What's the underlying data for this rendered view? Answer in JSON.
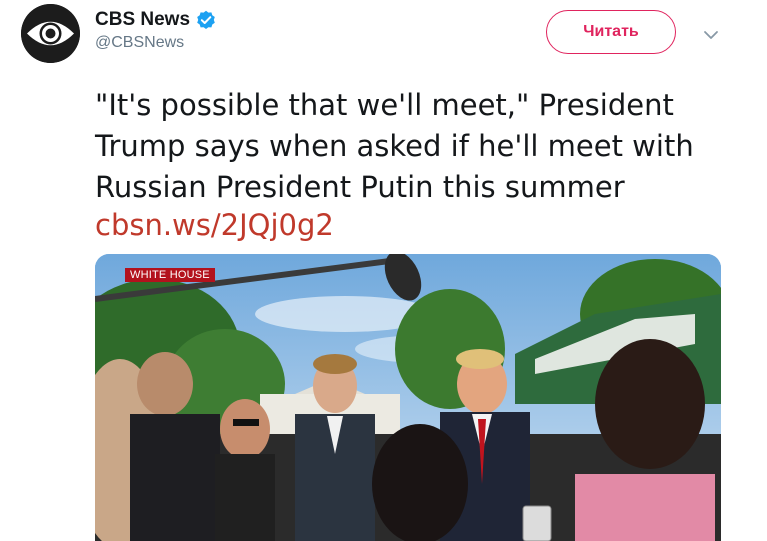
{
  "account": {
    "display_name": "CBS News",
    "handle": "@CBSNews",
    "verified": true,
    "avatar_icon": "cbs-eye-logo-icon"
  },
  "actions": {
    "follow_label": "Читать",
    "menu_icon": "chevron-down-icon"
  },
  "tweet": {
    "text": "\"It's possible that we'll meet,\" President Trump says when asked if he'll meet with Russian President Putin this summer",
    "link": "cbsn.ws/2JQj0g2"
  },
  "media": {
    "overlay_label": "WHITE HOUSE"
  },
  "colors": {
    "accent": "#e0245e",
    "link": "#c0392b",
    "verified": "#1da1f2",
    "text": "#14171a",
    "secondary": "#657786"
  }
}
